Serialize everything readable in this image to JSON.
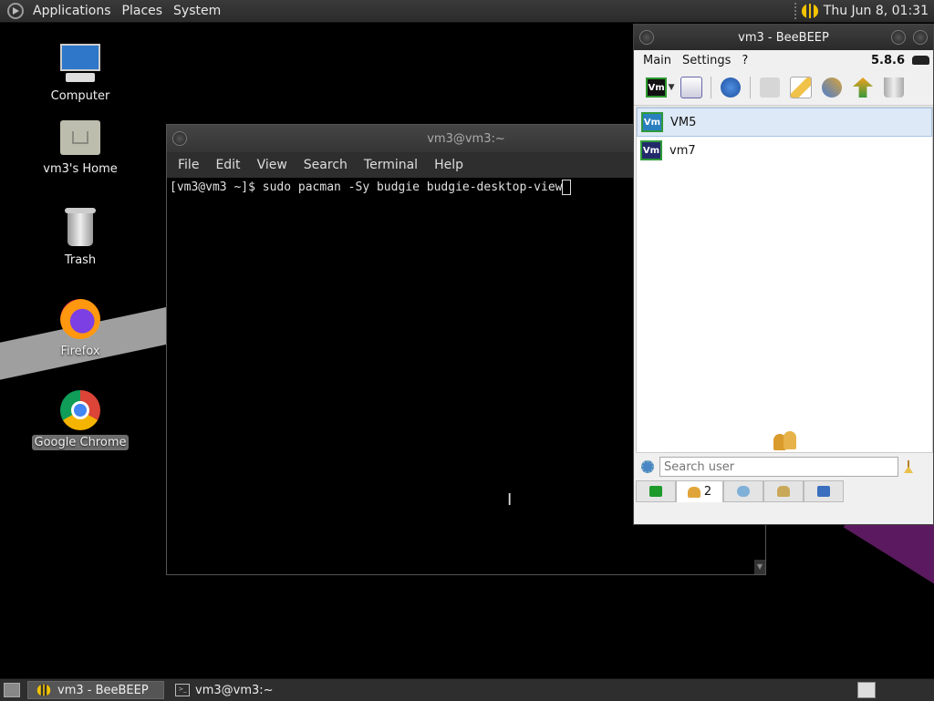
{
  "top_panel": {
    "menus": [
      "Applications",
      "Places",
      "System"
    ],
    "clock": "Thu Jun  8, 01:31"
  },
  "desktop": {
    "icons": [
      {
        "label": "Computer",
        "icon": "computer-icon"
      },
      {
        "label": "vm3's Home",
        "icon": "home-folder-icon"
      },
      {
        "label": "Trash",
        "icon": "trash-icon"
      },
      {
        "label": "Firefox",
        "icon": "firefox-icon"
      },
      {
        "label": "Google Chrome",
        "icon": "chrome-icon"
      }
    ]
  },
  "terminal": {
    "title": "vm3@vm3:~",
    "menus": [
      "File",
      "Edit",
      "View",
      "Search",
      "Terminal",
      "Help"
    ],
    "prompt": "[vm3@vm3 ~]$ ",
    "command": "sudo pacman -Sy budgie budgie-desktop-view"
  },
  "beebeep": {
    "title": "vm3 - BeeBEEP",
    "menus": [
      "Main",
      "Settings",
      "?"
    ],
    "version": "5.8.6",
    "my_badge": "Vm",
    "users": [
      {
        "badge": "Vm",
        "name": "VM5",
        "selected": true
      },
      {
        "badge": "Vm",
        "name": "vm7",
        "selected": false
      }
    ],
    "search_placeholder": "Search user",
    "users_tab_count": "2"
  },
  "taskbar": {
    "tasks": [
      {
        "label": "vm3 - BeeBEEP",
        "active": true
      },
      {
        "label": "vm3@vm3:~",
        "active": false
      }
    ]
  }
}
